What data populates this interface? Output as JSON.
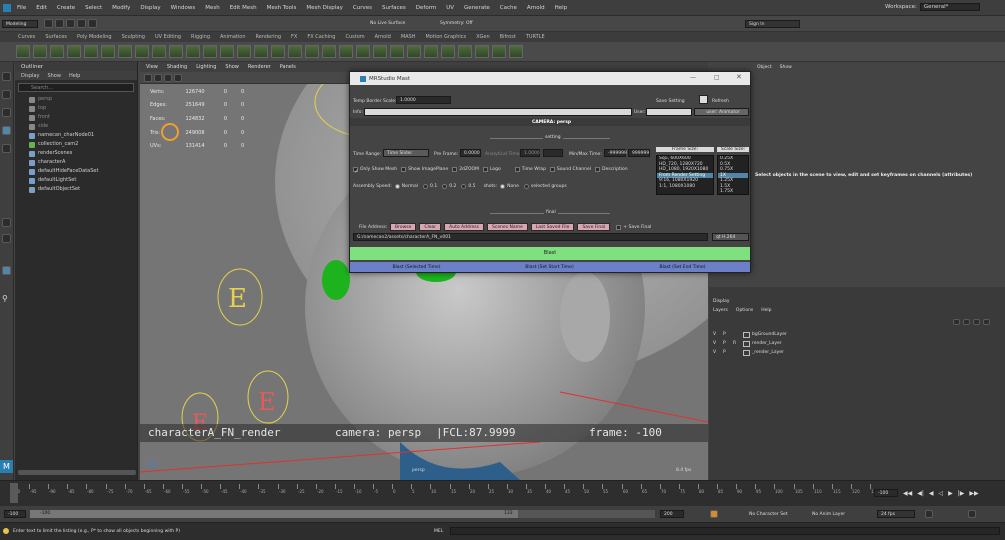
{
  "menubar": {
    "items": [
      "File",
      "Edit",
      "Create",
      "Select",
      "Modify",
      "Display",
      "Windows",
      "Mesh",
      "Edit Mesh",
      "Mesh Tools",
      "Mesh Display",
      "Curves",
      "Surfaces",
      "Deform",
      "UV",
      "Generate",
      "Cache",
      "Arnold",
      "Help"
    ],
    "workspace_label": "Workspace:",
    "workspace_value": "General*"
  },
  "toolbar": {
    "mode": "Modeling",
    "live_surface": "No Live Surface",
    "symmetry": "Symmetry: Off",
    "sign_in": "Sign In"
  },
  "shelf_tabs": [
    "Curves",
    "Surfaces",
    "Poly Modeling",
    "Sculpting",
    "UV Editing",
    "Rigging",
    "Animation",
    "Rendering",
    "FX",
    "FX Caching",
    "Custom",
    "Arnold",
    "MASH",
    "Motion Graphics",
    "XGen",
    "Bifrost",
    "TURTLE"
  ],
  "outliner": {
    "title": "Outliner",
    "menu": [
      "Display",
      "Show",
      "Help"
    ],
    "search_placeholder": "Search...",
    "items": [
      "persp",
      "top",
      "front",
      "side",
      "namecan_charNode01",
      "collection_cam2",
      "renderScenes",
      "characterA",
      "defaultHideFaceDataSet",
      "defaultLightSet",
      "defaultObjectSet"
    ]
  },
  "viewport": {
    "menu": [
      "View",
      "Shading",
      "Lighting",
      "Show",
      "Renderer",
      "Panels"
    ],
    "hud": [
      {
        "label": "Verts:",
        "a": "126740",
        "b": "0",
        "c": "0"
      },
      {
        "label": "Edges:",
        "a": "251649",
        "b": "0",
        "c": "0"
      },
      {
        "label": "Faces:",
        "a": "124832",
        "b": "0",
        "c": "0"
      },
      {
        "label": "Tris:",
        "a": "249008",
        "b": "0",
        "c": "0"
      },
      {
        "label": "UVs:",
        "a": "131414",
        "b": "0",
        "c": "0"
      }
    ],
    "camera_name": "characterA_FN_render",
    "camera_label": "camera: persp",
    "fcl": "|FCL:87.9999",
    "frame": "frame: -100",
    "cam_tag": "persp",
    "fps": "8.4 fps"
  },
  "dialog": {
    "title": "MRStudio Mast",
    "temp_border_label": "Temp Border Scale:",
    "temp_border_value": "1.0000",
    "save_setting": "Save Setting",
    "refresh": "Refresh",
    "info_label": "Info:",
    "user_label": "User:",
    "user_value": "user: Animator",
    "camera_label": "CAMERA: persp",
    "setting_label": "setting",
    "time_range_label": "Time Range:",
    "time_range_value": "Time Slider",
    "pre_frame_label": "Pre Frame:",
    "pre_frame_value": "0.0000",
    "analytical_label": "Analytical Time:",
    "analytical_value": "1.0000",
    "min_max_label": "Min/Max Time:",
    "min_value": "-999999",
    "max_value": "999999",
    "frame_size_label": "Frame Size:",
    "scale_size_label": "Scale Size:",
    "frame_sizes": [
      "Squ, 600X600",
      "HD_720, 1280X720",
      "HD_1080, 1920X1080",
      "From Render Setting",
      "9:16, 1080X1920",
      "1:1, 1080X1080"
    ],
    "frame_size_selected": 3,
    "scale_sizes": [
      "0.25X",
      "0.5X",
      "0.75X",
      "1X",
      "1.25X",
      "1.5X",
      "1.75X"
    ],
    "scale_size_selected": 3,
    "opt_only_show_mesh": "Only Show Mesh",
    "opt_show_imageplane": "Show ImagePlane",
    "opt_2dzoom": "2dZOOM",
    "opt_logo": "Logo",
    "opt_time_wrap": "Time Wrap",
    "opt_sound_channel": "Sound Channel",
    "opt_description": "Description",
    "assembly_speed_label": "Assembly Speed:",
    "speed_normal": "Normal",
    "speed_01": "0.1",
    "speed_02": "0.2",
    "speed_05": "0.5",
    "shots_label": "shots:",
    "shots_none": "None",
    "shots_selected": "selected groups",
    "final_label": "final",
    "file_address_label": "File Address:",
    "browse": "Browse",
    "clear": "Clear",
    "auto_address": "Auto Address",
    "scenes_name": "Scenes Name",
    "last_saved_file": "Last Saved File",
    "save_final": "Save Final",
    "plus_save_final": "+ Save Final",
    "path": "G:/namecan2/assets/characterA_FN_v001",
    "format": "qt H.264",
    "blast": "Blast",
    "blast_selected": "Blast (Selected Time)",
    "blast_start": "Blast (Set Start Time)",
    "blast_end": "Blast (Set End Time)",
    "colors": {
      "blast": "#7fe07f",
      "blast_row": "#6c7fc7",
      "btn": "#d9a5b2"
    }
  },
  "channel_box": {
    "menu": [
      "Object",
      "Show"
    ],
    "hint": "Select objects in the scene to view, edit and set keyframes on channels (attributes)"
  },
  "layers": {
    "menu_top": "Display",
    "menu": [
      "Layers",
      "Options",
      "Help"
    ],
    "items": [
      {
        "v": "V",
        "p": "P",
        "r": "",
        "name": "bgGroundLayer"
      },
      {
        "v": "V",
        "p": "P",
        "r": "R",
        "name": "render_Layer"
      },
      {
        "v": "V",
        "p": "P",
        "r": "",
        "name": "_render_Layer"
      }
    ]
  },
  "time_slider": {
    "ticks": [
      "-100",
      "-95",
      "-90",
      "-85",
      "-80",
      "-75",
      "-70",
      "-65",
      "-60",
      "-55",
      "-50",
      "-45",
      "-40",
      "-35",
      "-30",
      "-25",
      "-20",
      "-15",
      "-10",
      "-5",
      "0",
      "5",
      "10",
      "15",
      "20",
      "25",
      "30",
      "35",
      "40",
      "45",
      "50",
      "55",
      "60",
      "65",
      "70",
      "75",
      "80",
      "85",
      "90",
      "95",
      "100",
      "105",
      "110",
      "115",
      "120",
      "125"
    ],
    "current_frame": "-100",
    "range_start": "-100",
    "range_inner_start": "-100",
    "range_inner_end": "133",
    "range_end": "200",
    "character_set": "No Character Set",
    "anim_layer": "No Anim Layer",
    "fps_value": "24 fps"
  },
  "cmdline": {
    "help": "Enter text to limit the listing (e.g., P* to show all objects beginning with P)",
    "lang": "MEL"
  }
}
